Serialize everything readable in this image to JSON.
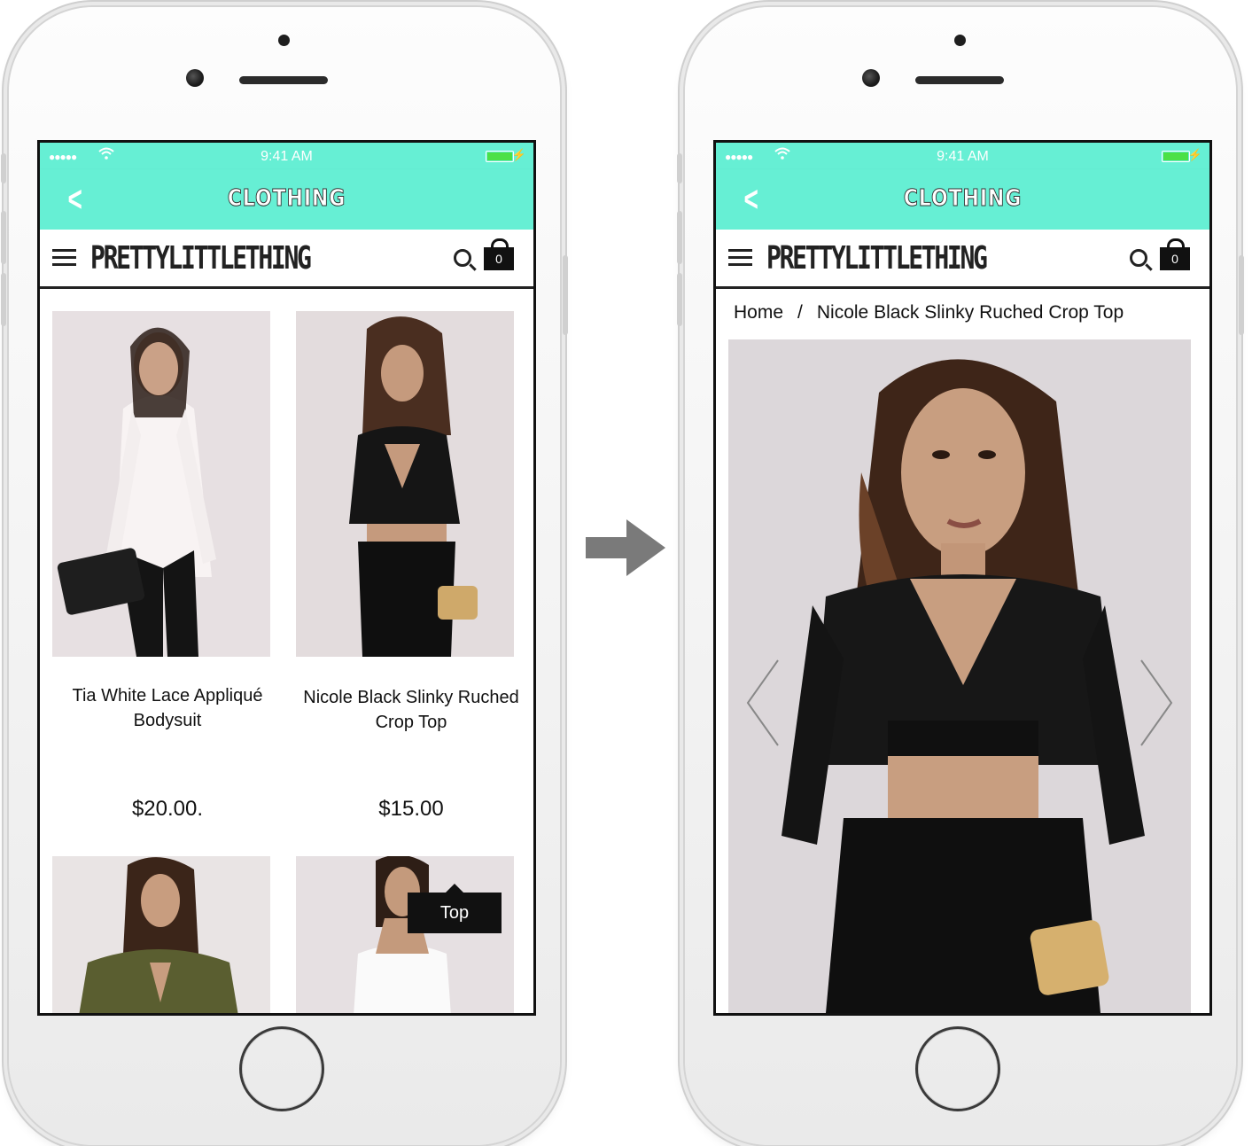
{
  "left_screen": {
    "status": {
      "time": "9:41 AM",
      "signal": "●●●●●",
      "wifi": "wifi-icon"
    },
    "nav": {
      "back": "back-chevron-icon",
      "title": "CLOTHING"
    },
    "store": {
      "logo": "PRETTYLITTLETHING",
      "cart_count": "0"
    },
    "products": [
      {
        "name": "Tia White Lace Appliqué Bodysuit",
        "price": "$20.00."
      },
      {
        "name": "Nicole Black Slinky Ruched Crop Top",
        "price": "$15.00"
      },
      {
        "name": "",
        "price": ""
      },
      {
        "name": "",
        "price": ""
      }
    ],
    "top_button": "Top"
  },
  "right_screen": {
    "status": {
      "time": "9:41 AM",
      "signal": "●●●●●",
      "wifi": "wifi-icon"
    },
    "nav": {
      "back": "back-chevron-icon",
      "title": "CLOTHING"
    },
    "store": {
      "logo": "PRETTYLITTLETHING",
      "cart_count": "0"
    },
    "breadcrumb": {
      "home": "Home",
      "separator": "/",
      "current": "Nicole Black Slinky Ruched Crop Top"
    }
  },
  "transition_arrow": "right-arrow-icon",
  "colors": {
    "accent": "#66efd4",
    "text": "#111111",
    "battery": "#4ce046"
  }
}
